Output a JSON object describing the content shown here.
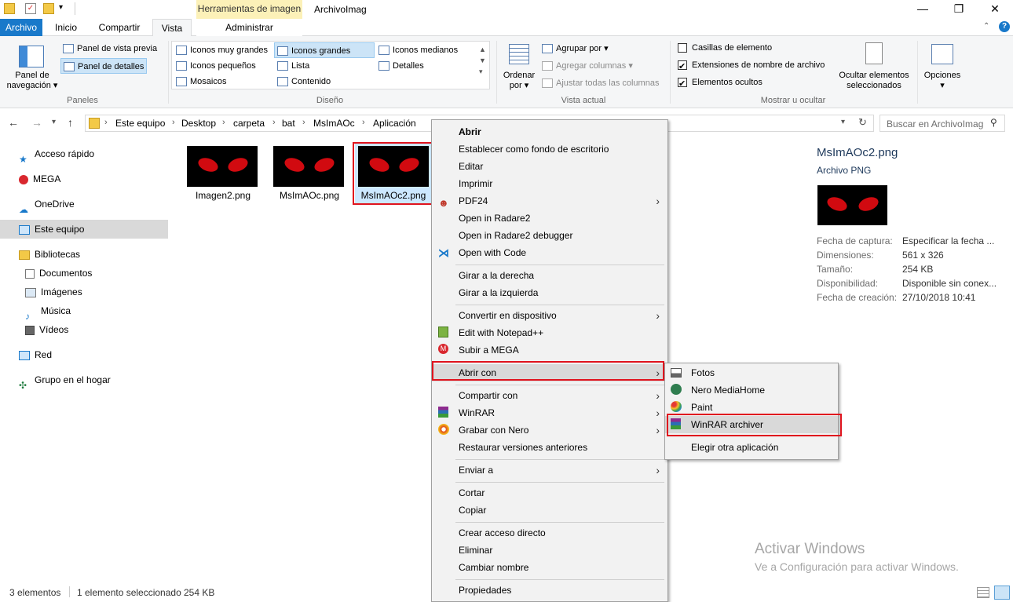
{
  "window": {
    "title": "ArchivoImag",
    "tool_tab_group": "Herramientas de imagen"
  },
  "tabs": {
    "archivo": "Archivo",
    "inicio": "Inicio",
    "compartir": "Compartir",
    "vista": "Vista",
    "administrar": "Administrar"
  },
  "ribbon": {
    "paneles": {
      "label": "Paneles",
      "nav_pane": "Panel de\nnavegación",
      "nav_pane_line1": "Panel de",
      "nav_pane_line2": "navegación",
      "preview": "Panel de vista previa",
      "details": "Panel de detalles"
    },
    "diseno": {
      "label": "Diseño",
      "items": [
        "Iconos muy grandes",
        "Iconos grandes",
        "Iconos medianos",
        "Iconos pequeños",
        "Lista",
        "Detalles",
        "Mosaicos",
        "Contenido"
      ]
    },
    "vista_actual": {
      "label": "Vista actual",
      "ordenar_line1": "Ordenar",
      "ordenar_line2": "por",
      "agrupar": "Agrupar por",
      "agregar_columnas": "Agregar columnas",
      "ajustar": "Ajustar todas las columnas"
    },
    "mostrar": {
      "label": "Mostrar u ocultar",
      "casillas": "Casillas de elemento",
      "extensiones": "Extensiones de nombre de archivo",
      "ocultos": "Elementos ocultos",
      "ocultar_line1": "Ocultar elementos",
      "ocultar_line2": "seleccionados"
    },
    "opciones": "Opciones"
  },
  "address": {
    "crumbs": [
      "Este equipo",
      "Desktop",
      "carpeta",
      "bat",
      "MsImAOc",
      "Aplicación"
    ],
    "search_placeholder": "Buscar en ArchivoImag"
  },
  "sidebar": {
    "items": [
      "Acceso rápido",
      "MEGA",
      "OneDrive",
      "Este equipo",
      "Bibliotecas",
      "Documentos",
      "Imágenes",
      "Música",
      "Vídeos",
      "Red",
      "Grupo en el hogar"
    ]
  },
  "files": [
    {
      "name": "Imagen2.png"
    },
    {
      "name": "MsImAOc.png"
    },
    {
      "name": "MsImAOc2.png"
    }
  ],
  "details": {
    "filename": "MsImAOc2.png",
    "filetype": "Archivo PNG",
    "labels": [
      "Fecha de captura:",
      "Dimensiones:",
      "Tamaño:",
      "Disponibilidad:",
      "Fecha de creación:"
    ],
    "values": [
      "Especificar la fecha ...",
      "561 x 326",
      "254 KB",
      "Disponible sin conex...",
      "27/10/2018 10:41"
    ]
  },
  "context_menu": {
    "items": [
      "Abrir",
      "Establecer como fondo de escritorio",
      "Editar",
      "Imprimir",
      "PDF24",
      "Open in Radare2",
      "Open in Radare2 debugger",
      "Open with Code",
      "Girar a la derecha",
      "Girar a la izquierda",
      "Convertir en dispositivo",
      "Edit with Notepad++",
      "Subir a MEGA",
      "Abrir con",
      "Compartir con",
      "WinRAR",
      "Grabar con Nero",
      "Restaurar versiones anteriores",
      "Enviar a",
      "Cortar",
      "Copiar",
      "Crear acceso directo",
      "Eliminar",
      "Cambiar nombre",
      "Propiedades"
    ]
  },
  "submenu": {
    "items": [
      "Fotos",
      "Nero MediaHome",
      "Paint",
      "WinRAR archiver",
      "Elegir otra aplicación"
    ]
  },
  "status": {
    "count": "3 elementos",
    "selection": "1 elemento seleccionado",
    "size": "254 KB"
  },
  "watermark": {
    "line1": "Activar Windows",
    "line2": "Ve a Configuración para activar Windows."
  },
  "colors": {
    "accent": "#1979ca",
    "highlight": "#e0141e",
    "eyes": "#d10a10"
  }
}
